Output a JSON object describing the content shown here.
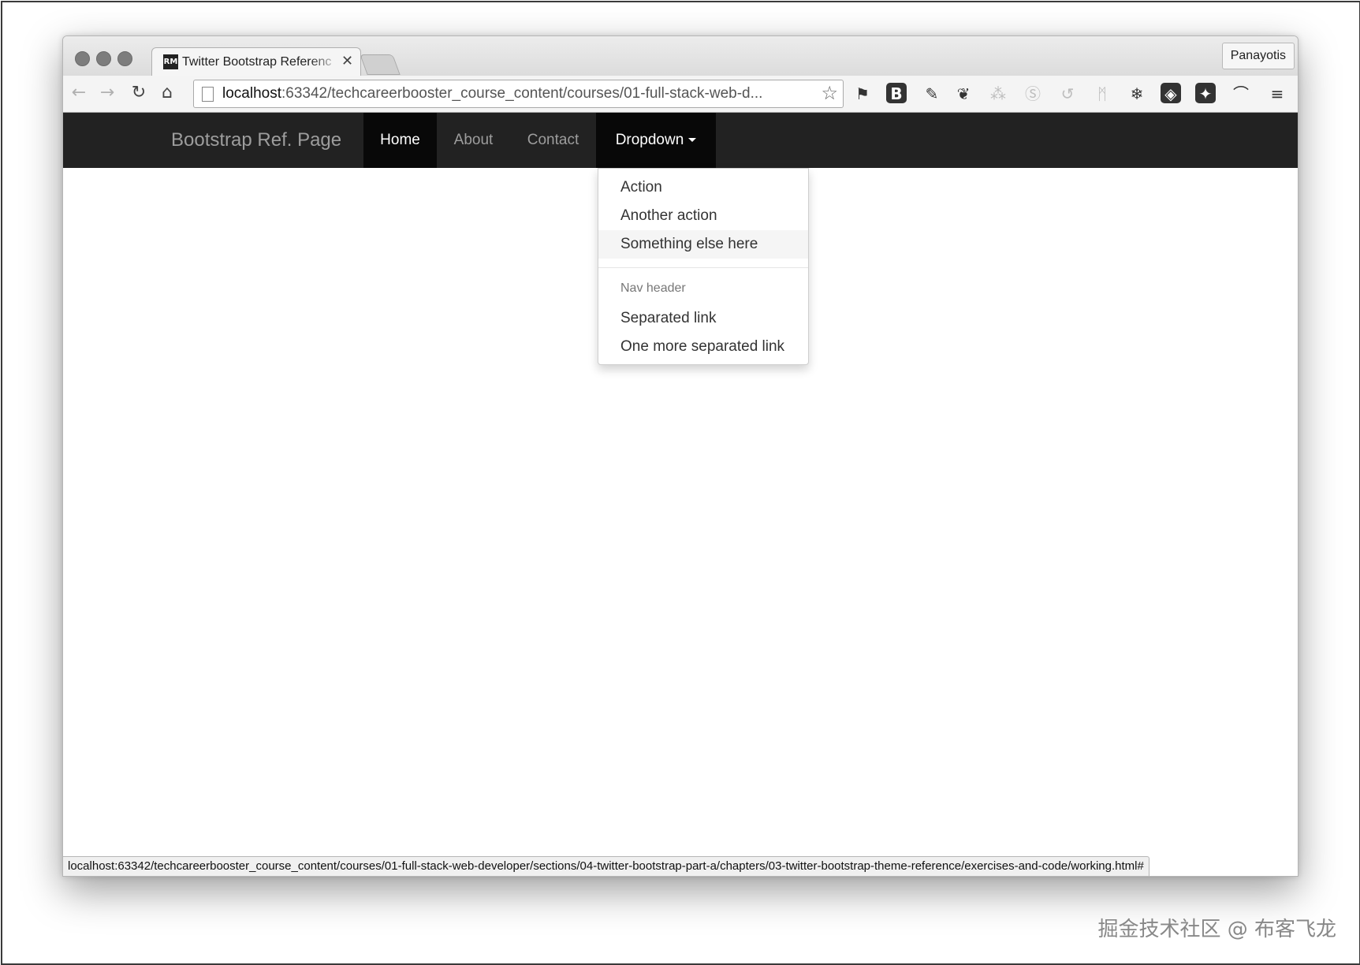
{
  "browser": {
    "tab_title": "Twitter Bootstrap Referenc",
    "tab_favicon_text": "RM",
    "tab_close": "✕",
    "profile_name": "Panayotis",
    "url_host": "localhost",
    "url_rest": ":63342/techcareerbooster_course_content/courses/01-full-stack-web-d...",
    "status_url": "localhost:63342/techcareerbooster_course_content/courses/01-full-stack-web-developer/sections/04-twitter-bootstrap-part-a/chapters/03-twitter-bootstrap-theme-reference/exercises-and-code/working.html#",
    "icons": {
      "back": "back-arrow-icon",
      "forward": "forward-arrow-icon",
      "reload": "reload-icon",
      "home": "home-icon",
      "bookmark": "star-icon",
      "menu": "hamburger-menu-icon"
    },
    "extension_b_label": "B"
  },
  "navbar": {
    "brand": "Bootstrap Ref. Page",
    "items": [
      {
        "label": "Home",
        "active": true
      },
      {
        "label": "About",
        "active": false
      },
      {
        "label": "Contact",
        "active": false
      },
      {
        "label": "Dropdown",
        "active": true
      }
    ]
  },
  "dropdown": {
    "items": [
      "Action",
      "Another action",
      "Something else here"
    ],
    "header": "Nav header",
    "separated_items": [
      "Separated link",
      "One more separated link"
    ],
    "hovered_index": 2
  },
  "watermark": "掘金技术社区 @ 布客飞龙"
}
